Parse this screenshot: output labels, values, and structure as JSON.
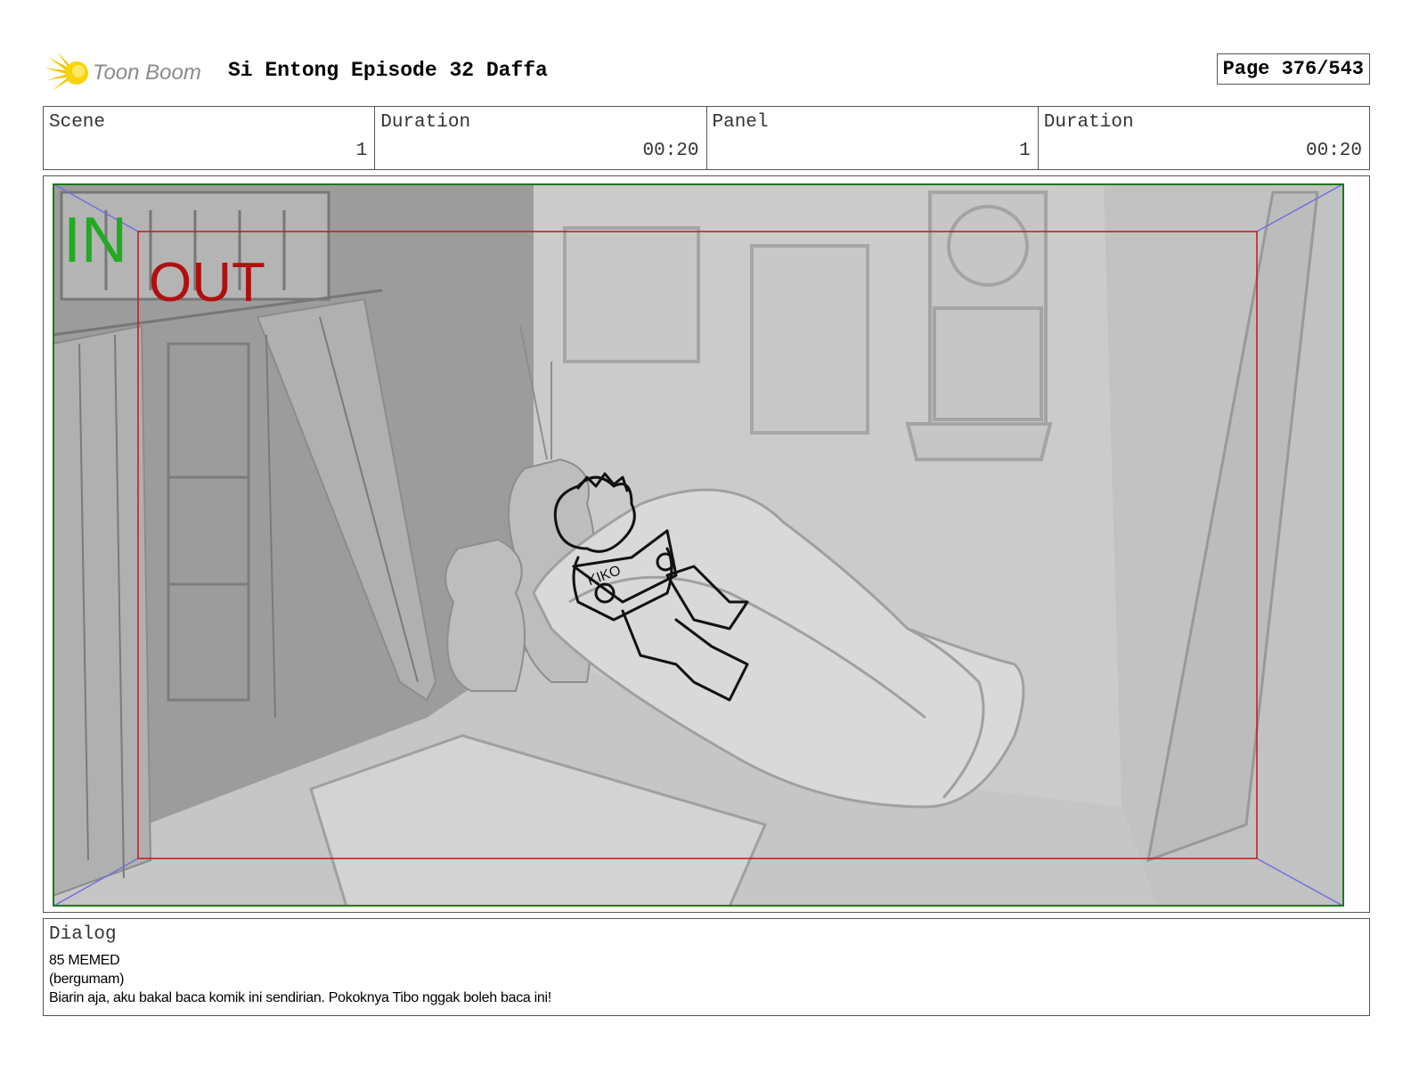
{
  "header": {
    "logo_text": "Toon Boom",
    "title": "Si Entong Episode 32 Daffa",
    "page": "Page 376/543"
  },
  "info": {
    "scene_label": "Scene",
    "scene_value": "1",
    "scene_duration_label": "Duration",
    "scene_duration_value": "00:20",
    "panel_label": "Panel",
    "panel_value": "1",
    "panel_duration_label": "Duration",
    "panel_duration_value": "00:20"
  },
  "panel": {
    "in_label": "IN",
    "out_label": "OUT",
    "comic_text": "KIKO",
    "colors": {
      "in_frame": "#1a7a1a",
      "in_text": "#22aa22",
      "out_frame": "#c01818",
      "out_text": "#b01010",
      "camera_lines": "#7070e0"
    }
  },
  "dialog": {
    "label": "Dialog",
    "line1": "85 MEMED",
    "line2": "(bergumam)",
    "line3": "Biarin aja, aku bakal baca komik ini sendirian. Pokoknya Tibo nggak boleh baca ini!"
  }
}
